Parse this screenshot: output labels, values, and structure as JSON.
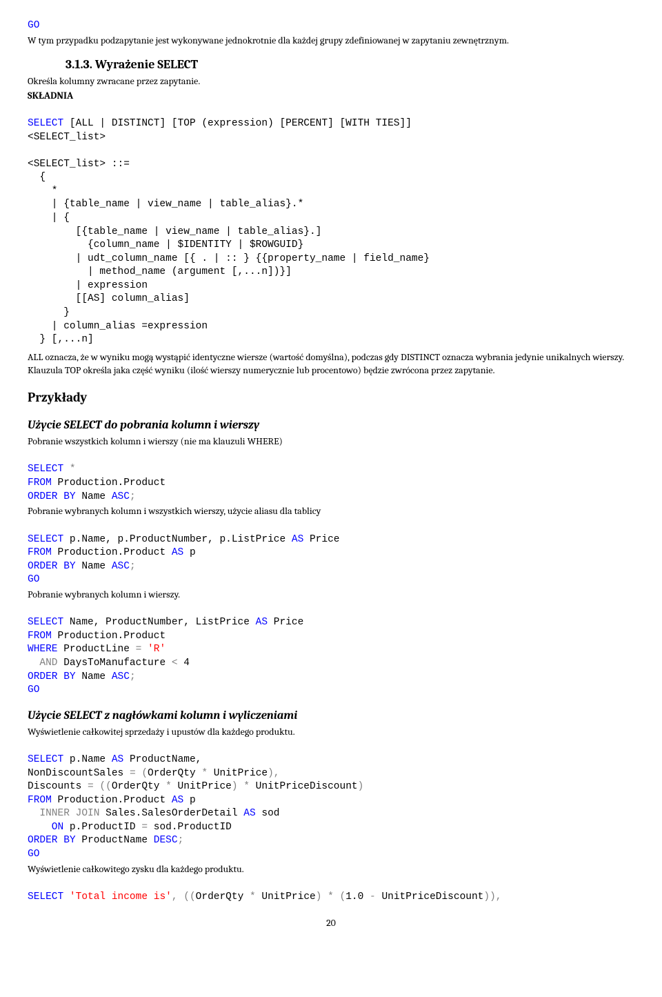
{
  "top": {
    "go": "GO",
    "intro": "W tym przypadku podzapytanie jest wykonywane jednokrotnie dla każdej grupy zdefiniowanej w zapytaniu zewnętrznym."
  },
  "h313": "3.1.3. Wyrażenie SELECT",
  "h313_desc": "Określa kolumny zwracane przez zapytanie.",
  "skladnia_label": "SKŁADNIA",
  "syntax": {
    "l1a": "SELECT",
    "l1b": " [ALL | DISTINCT] [TOP (expression) [PERCENT] [WITH TIES]]",
    "l2": "<SELECT_list>",
    "l3": "<SELECT_list> ::=",
    "l4": "  {",
    "l5": "    *",
    "l6": "    | {table_name | view_name | table_alias}.*",
    "l7": "    | {",
    "l8": "        [{table_name | view_name | table_alias}.]",
    "l9": "          {column_name | $IDENTITY | $ROWGUID}",
    "l10": "        | udt_column_name [{ . | :: } {{property_name | field_name}",
    "l11": "          | method_name (argument [,...n])}]",
    "l12": "        | expression",
    "l13": "        [[AS] column_alias]",
    "l14": "      }",
    "l15": "    | column_alias =expression",
    "l16": "  } [,...n]"
  },
  "all_desc": "ALL oznacza, że w wyniku mogą wystąpić identyczne wiersze (wartość domyślna), podczas gdy DISTINCT oznacza wybrania jedynie unikalnych wierszy. Klauzula TOP określa jaka część wyniku (ilość wierszy numerycznie lub procentowo) będzie zwrócona przez zapytanie.",
  "przyklady": "Przykłady",
  "ex1": {
    "h": "Użycie SELECT do pobrania kolumn i wierszy",
    "p1": "Pobranie wszystkich kolumn i wierszy (nie ma klauzuli WHERE)",
    "c1a": "SELECT",
    "c1b": " *",
    "c2a": "FROM",
    "c2b": " Production.Product",
    "c3a": "ORDER BY",
    "c3b": " Name ",
    "c3c": "ASC",
    "c3d": ";",
    "p2": "Pobranie wybranych kolumn i wszystkich wierszy, użycie aliasu dla tablicy",
    "c4a": "SELECT",
    "c4b": " p.Name, p.ProductNumber, p.ListPrice ",
    "c4c": "AS",
    "c4d": " Price",
    "c5a": "FROM",
    "c5b": " Production.Product ",
    "c5c": "AS",
    "c5d": " p",
    "c6a": "ORDER BY",
    "c6b": " Name ",
    "c6c": "ASC",
    "c6d": ";",
    "c7": "GO",
    "p3": "Pobranie wybranych kolumn i wierszy.",
    "c8a": "SELECT",
    "c8b": " Name, ProductNumber, ListPrice ",
    "c8c": "AS",
    "c8d": " Price",
    "c9a": "FROM",
    "c9b": " Production.Product",
    "c10a": "WHERE",
    "c10b": " ProductLine ",
    "c10c": "=",
    "c10d": " ",
    "c10e": "'R'",
    "c11a": "  AND",
    "c11b": " DaysToManufacture ",
    "c11c": "<",
    "c11d": " 4",
    "c12a": "ORDER BY",
    "c12b": " Name ",
    "c12c": "ASC",
    "c12d": ";",
    "c13": "GO"
  },
  "ex2": {
    "h": "Użycie SELECT z nagłówkami kolumn i wyliczeniami",
    "p1": "Wyświetlenie całkowitej sprzedaży i upustów dla każdego produktu.",
    "c1a": "SELECT",
    "c1b": " p.Name ",
    "c1c": "AS",
    "c1d": " ProductName,",
    "c2a": "NonDiscountSales ",
    "c2b": "=",
    "c2c": " ",
    "c2d": "(",
    "c2e": "OrderQty ",
    "c2f": "*",
    "c2g": " UnitPrice",
    "c2h": "),",
    "c3a": "Discounts ",
    "c3b": "=",
    "c3c": " ",
    "c3d": "((",
    "c3e": "OrderQty ",
    "c3f": "*",
    "c3g": " UnitPrice",
    "c3h": ")",
    "c3i": " ",
    "c3j": "*",
    "c3k": " UnitPriceDiscount",
    "c3l": ")",
    "c4a": "FROM",
    "c4b": " Production.Product ",
    "c4c": "AS",
    "c4d": " p",
    "c5a": "  INNER JOIN",
    "c5b": " Sales.SalesOrderDetail ",
    "c5c": "AS",
    "c5d": " sod",
    "c6a": "    ON",
    "c6b": " p.ProductID ",
    "c6c": "=",
    "c6d": " sod.ProductID",
    "c7a": "ORDER BY",
    "c7b": " ProductName ",
    "c7c": "DESC",
    "c7d": ";",
    "c8": "GO",
    "p2": "Wyświetlenie całkowitego zysku dla każdego produktu.",
    "c9a": "SELECT",
    "c9b": " ",
    "c9c": "'Total income is'",
    "c9d": ",",
    "c9e": " ",
    "c9f": "((",
    "c9g": "OrderQty ",
    "c9h": "*",
    "c9i": " UnitPrice",
    "c9j": ")",
    "c9k": " ",
    "c9l": "*",
    "c9m": " ",
    "c9n": "(",
    "c9o": "1.0 ",
    "c9p": "-",
    "c9q": " UnitPriceDiscount",
    "c9r": ")),"
  },
  "pagenum": "20"
}
